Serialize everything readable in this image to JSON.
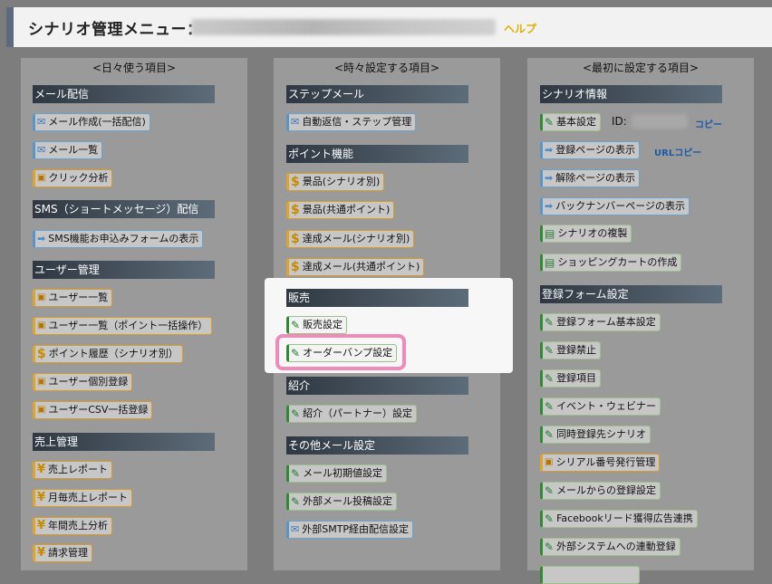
{
  "header": {
    "title": "シナリオ管理メニュー：",
    "help": "ヘルプ"
  },
  "columns": {
    "daily": {
      "heading": "<日々使う項目>",
      "mail_section": "メール配信",
      "mail_create": "メール作成(一括配信)",
      "mail_list": "メール一覧",
      "click_analysis": "クリック分析",
      "sms_section": "SMS（ショートメッセージ）配信",
      "sms_form": "SMS機能お申込みフォームの表示",
      "user_section": "ユーザー管理",
      "user_list": "ユーザー一覧",
      "user_bulk": "ユーザー一覧（ポイント一括操作）",
      "point_history": "ポイント履歴（シナリオ別）",
      "user_register": "ユーザー個別登録",
      "user_csv": "ユーザーCSV一括登録",
      "sales_section": "売上管理",
      "sales_report": "売上レポート",
      "monthly_report": "月毎売上レポート",
      "yearly_analysis": "年間売上分析",
      "billing": "請求管理"
    },
    "sometimes": {
      "heading": "<時々設定する項目>",
      "step_section": "ステップメール",
      "auto_reply": "自動返信・ステップ管理",
      "point_section": "ポイント機能",
      "prize_scenario": "景品(シナリオ別)",
      "prize_common": "景品(共通ポイント)",
      "achieve_scenario": "達成メール(シナリオ別)",
      "achieve_common": "達成メール(共通ポイント)",
      "sales_section": "販売",
      "sales_settings": "販売設定",
      "order_bump": "オーダーバンプ設定",
      "referral_section": "紹介",
      "referral_partner": "紹介（パートナー）設定",
      "other_section": "その他メール設定",
      "mail_initial": "メール初期値設定",
      "external_mail": "外部メール投稿設定",
      "external_smtp": "外部SMTP経由配信設定"
    },
    "initial": {
      "heading": "<最初に設定する項目>",
      "scenario_section": "シナリオ情報",
      "basic_settings": "基本設定",
      "id_label": "ID:",
      "copy": "コピー",
      "register_page": "登録ページの表示",
      "url_copy": "URLコピー",
      "cancel_page": "解除ページの表示",
      "backnumber_page": "バックナンバーページの表示",
      "scenario_copy": "シナリオの複製",
      "cart_create": "ショッピングカートの作成",
      "form_section": "登録フォーム設定",
      "form_basic": "登録フォーム基本設定",
      "form_ban": "登録禁止",
      "form_items": "登録項目",
      "event_webinar": "イベント・ウェビナー",
      "simultaneous": "同時登録先シナリオ",
      "serial_number": "シリアル番号発行管理",
      "register_from_mail": "メールからの登録設定",
      "facebook_leads": "Facebookリード獲得広告連携",
      "external_system": "外部システムへの連動登録"
    }
  }
}
